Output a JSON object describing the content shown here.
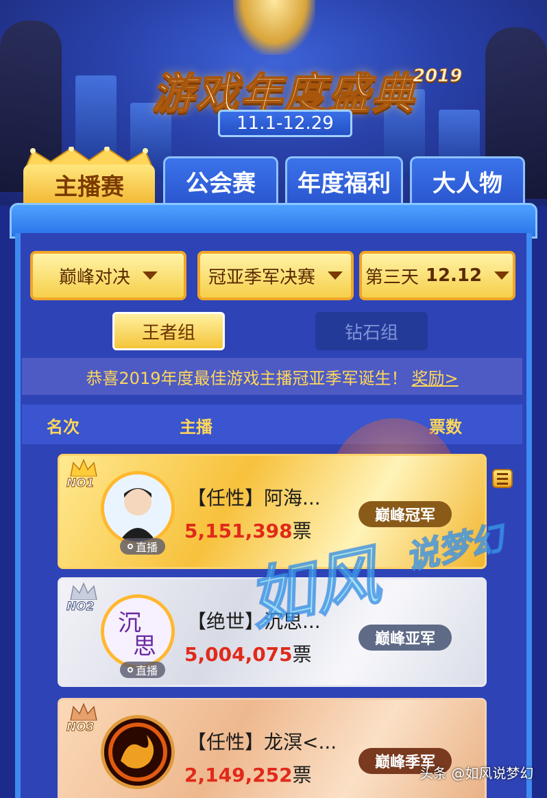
{
  "banner": {
    "title": "游戏年度盛典",
    "year": "2019",
    "dates": "11.1-12.29"
  },
  "tabs": [
    {
      "label": "主播赛",
      "active": true
    },
    {
      "label": "公会赛",
      "active": false
    },
    {
      "label": "年度福利",
      "active": false
    },
    {
      "label": "大人物",
      "active": false
    }
  ],
  "filters": {
    "stage": "巅峰对决",
    "round": "冠亚季军决赛",
    "day_label": "第三天",
    "day_date": "12.12"
  },
  "groups": {
    "selected": "王者组",
    "other": "钻石组"
  },
  "notice": {
    "text": "恭喜2019年度最佳游戏主播冠亚季军诞生！",
    "link": "奖励>"
  },
  "table": {
    "col_rank": "名次",
    "col_streamer": "主播",
    "col_votes": "票数"
  },
  "entries": [
    {
      "rank": "NO1",
      "name": "【任性】阿海...",
      "votes": "5,151,398",
      "unit": "票",
      "badge": "巅峰冠军",
      "live": "直播"
    },
    {
      "rank": "NO2",
      "name": "【绝世】沉思...",
      "votes": "5,004,075",
      "unit": "票",
      "badge": "巅峰亚军",
      "live": "直播"
    },
    {
      "rank": "NO3",
      "name": "【任性】龙溟<...",
      "votes": "2,149,252",
      "unit": "票",
      "badge": "巅峰季军"
    }
  ],
  "watermark": {
    "big": "如风",
    "small": "说梦幻",
    "footer": "头条 @如风说梦幻"
  },
  "colors": {
    "gold": "#f6cf4a",
    "panel_blue": "#2e43b6",
    "vote_red": "#e02a1a"
  }
}
